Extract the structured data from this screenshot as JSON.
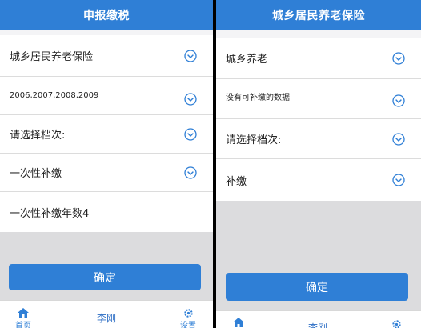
{
  "left": {
    "title": "申报缴税",
    "rows": [
      {
        "text": "城乡居民养老保险"
      },
      {
        "text": "2006,2007,2008,2009"
      },
      {
        "text": "请选择档次:"
      },
      {
        "text": "一次性补缴"
      },
      {
        "text": "一次性补缴年数4"
      }
    ],
    "confirm_label": "确定",
    "tabs": {
      "home": "首页",
      "user": "李刚",
      "settings": "设置"
    }
  },
  "right": {
    "title": "城乡居民养老保险",
    "rows": [
      {
        "text": "城乡养老"
      },
      {
        "text": "没有可补缴的数据"
      },
      {
        "text": "请选择档次:"
      },
      {
        "text": "补缴"
      }
    ],
    "confirm_label": "确定",
    "tabs": {
      "user": "李刚"
    }
  },
  "colors": {
    "primary": "#2f7fd6",
    "background": "#f4f4f6",
    "grey_area": "#dcdcde"
  }
}
